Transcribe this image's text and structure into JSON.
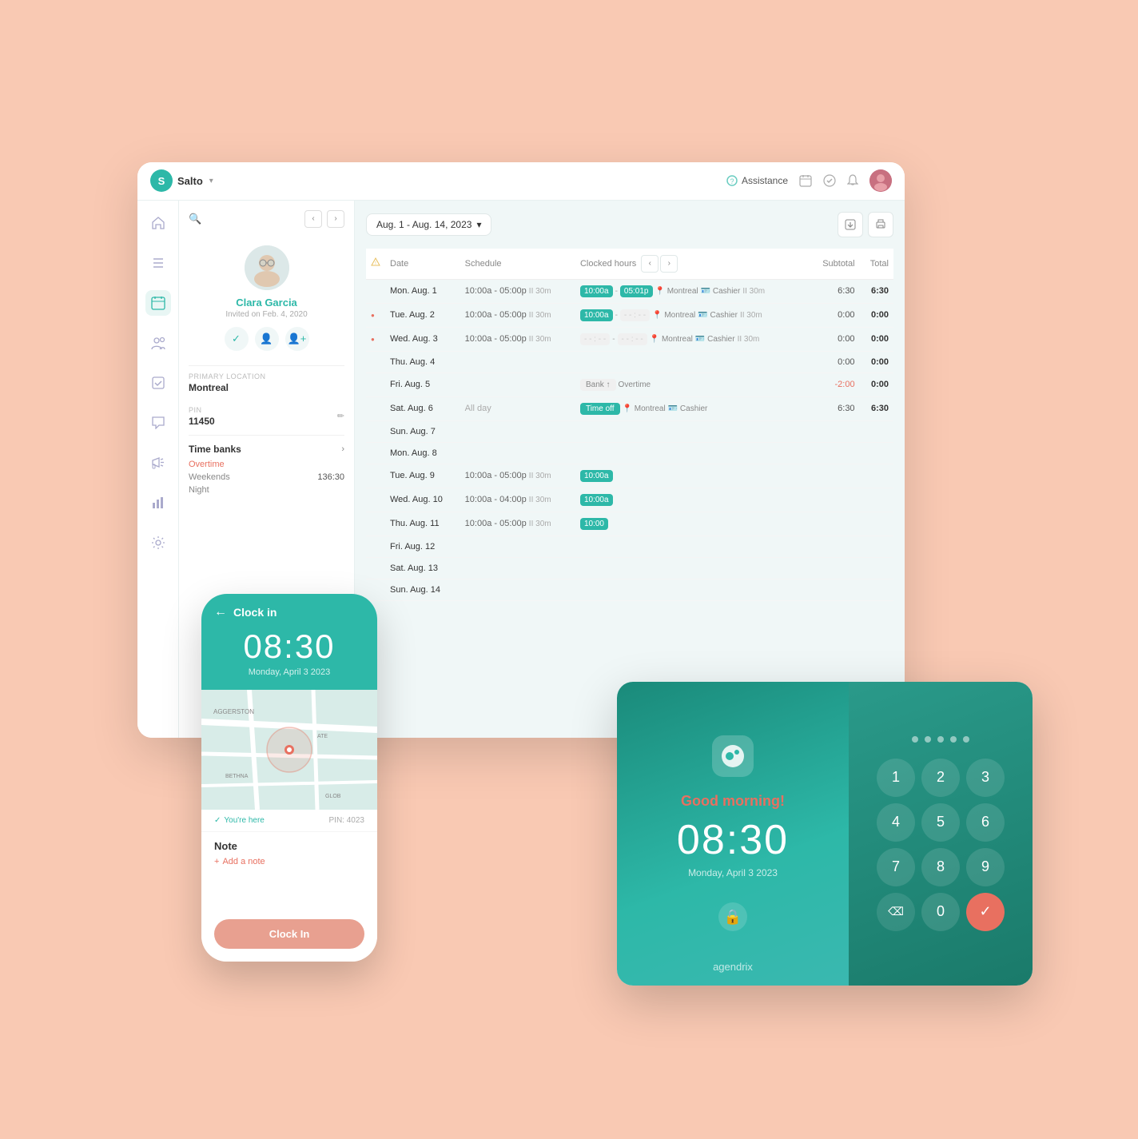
{
  "brand": {
    "name": "Salto",
    "logo": "S"
  },
  "nav": {
    "assistance_label": "Assistance",
    "avatar_alt": "User avatar"
  },
  "user": {
    "name": "Clara Garcia",
    "invited": "Invited on Feb. 4, 2020",
    "primary_location_label": "Primary location",
    "primary_location": "Montreal",
    "pin_label": "PIN",
    "pin": "11450",
    "time_banks_label": "Time banks",
    "overtime_label": "Overtime",
    "weekends_label": "Weekends",
    "weekends_value": "136:30",
    "night_label": "Night"
  },
  "schedule": {
    "date_range": "Aug. 1 - Aug. 14, 2023",
    "columns": {
      "date": "Date",
      "schedule": "Schedule",
      "clocked_hours": "Clocked hours",
      "subtotal": "Subtotal",
      "total": "Total"
    },
    "rows": [
      {
        "date": "Mon. Aug. 1",
        "schedule": "10:00a - 05:00p",
        "schedule_duration": "II 30m",
        "clocked_start": "10:00a",
        "clocked_end": "05:01p",
        "clocked_duration": "II 30m",
        "location": "Montreal",
        "role": "Cashier",
        "role_duration": "II 30m",
        "subtotal": "6:30",
        "total": "6:30",
        "has_warning": false
      },
      {
        "date": "Tue. Aug. 2",
        "schedule": "10:00a - 05:00p",
        "schedule_duration": "II 30m",
        "clocked_start": "10:00a",
        "clocked_end": "",
        "clocked_duration": "II 30m",
        "location": "Montreal",
        "role": "Cashier",
        "role_duration": "II 30m",
        "subtotal": "0:00",
        "total": "0:00",
        "has_warning": true
      },
      {
        "date": "Wed. Aug. 3",
        "schedule": "10:00a - 05:00p",
        "schedule_duration": "II 30m",
        "clocked_start": "",
        "clocked_end": "",
        "location": "Montreal",
        "role": "Cashier",
        "role_duration": "II 30m",
        "subtotal": "0:00",
        "total": "0:00",
        "has_warning": true
      },
      {
        "date": "Thu. Aug. 4",
        "schedule": "",
        "subtotal": "0:00",
        "total": "0:00",
        "has_warning": false
      },
      {
        "date": "Fri. Aug. 5",
        "schedule": "",
        "bank": "Bank ↑",
        "overtime": "Overtime",
        "subtotal": "-2:00",
        "total": "0:00",
        "has_warning": false
      },
      {
        "date": "Sat. Aug. 6",
        "schedule": "All day",
        "time_off": "Time off",
        "location": "Montreal",
        "role": "Cashier",
        "subtotal": "6:30",
        "total": "6:30",
        "has_warning": false
      },
      {
        "date": "Sun. Aug. 7",
        "schedule": "",
        "subtotal": "",
        "total": "",
        "has_warning": false
      },
      {
        "date": "Mon. Aug. 8",
        "schedule": "",
        "subtotal": "",
        "total": "",
        "has_warning": false
      },
      {
        "date": "Tue. Aug. 9",
        "schedule": "10:00a - 05:00p",
        "schedule_duration": "II 30m",
        "clocked_start": "10:00a",
        "subtotal": "",
        "total": "",
        "has_warning": false
      },
      {
        "date": "Wed. Aug. 10",
        "schedule": "10:00a - 04:00p",
        "schedule_duration": "II 30m",
        "clocked_start": "10:00a",
        "subtotal": "",
        "total": "",
        "has_warning": false
      },
      {
        "date": "Thu. Aug. 11",
        "schedule": "10:00a - 05:00p",
        "schedule_duration": "II 30m",
        "clocked_start": "10:00",
        "subtotal": "",
        "total": "",
        "has_warning": false
      },
      {
        "date": "Fri. Aug. 12",
        "schedule": "",
        "subtotal": "",
        "total": "",
        "has_warning": false
      },
      {
        "date": "Sat. Aug. 13",
        "schedule": "",
        "subtotal": "",
        "total": "",
        "has_warning": false
      },
      {
        "date": "Sun. Aug. 14",
        "schedule": "",
        "subtotal": "",
        "total": "",
        "has_warning": false
      }
    ]
  },
  "phone": {
    "header_title": "Clock in",
    "time": "08:30",
    "date": "Monday, April 3 2023",
    "location_check": "You're here",
    "pin_info": "PIN: 4023",
    "note_title": "Note",
    "note_placeholder": "Add a note",
    "clock_in_button": "Clock In",
    "map_labels": [
      "AGGERSTON",
      "ATE",
      "BETHNA",
      "GLOB"
    ]
  },
  "tablet": {
    "greeting": "Good morning!",
    "time": "08:30",
    "date": "Monday, April 3 2023",
    "brand": "agendrix",
    "numpad": [
      "1",
      "2",
      "3",
      "4",
      "5",
      "6",
      "7",
      "8",
      "9",
      "",
      "0",
      "✓"
    ],
    "delete": "⌫"
  }
}
